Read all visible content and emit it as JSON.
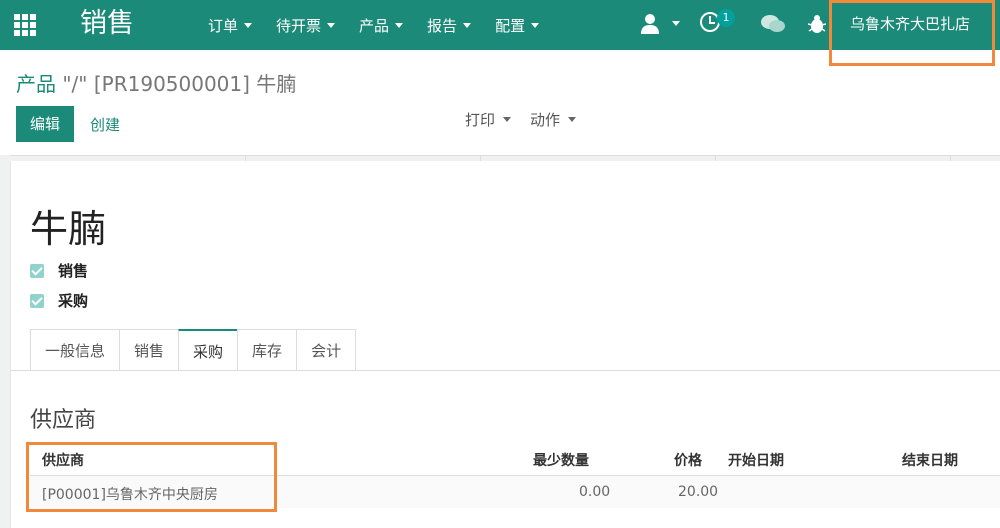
{
  "navbar": {
    "app_title": "销售",
    "menu": [
      "订单",
      "待开票",
      "产品",
      "报告",
      "配置"
    ],
    "activity_count": "1",
    "company": "乌鲁木齐大巴扎店"
  },
  "control_panel": {
    "breadcrumb_link": "产品",
    "breadcrumb_current": "\"/\" [PR190500001] 牛腩",
    "edit_label": "编辑",
    "create_label": "创建",
    "print_label": "打印",
    "action_label": "动作"
  },
  "form": {
    "product_name": "牛腩",
    "checkboxes": [
      {
        "label": "销售",
        "checked": true
      },
      {
        "label": "采购",
        "checked": true
      }
    ],
    "tabs": [
      {
        "label": "一般信息",
        "active": false
      },
      {
        "label": "销售",
        "active": false
      },
      {
        "label": "采购",
        "active": true
      },
      {
        "label": "库存",
        "active": false
      },
      {
        "label": "会计",
        "active": false
      }
    ],
    "section_title": "供应商",
    "vendor_table": {
      "headers": [
        "供应商",
        "最少数量",
        "价格",
        "开始日期",
        "结束日期"
      ],
      "rows": [
        {
          "vendor": "[P00001]乌鲁木齐中央厨房",
          "min_qty": "0.00",
          "price": "20.00",
          "start_date": "",
          "end_date": ""
        }
      ]
    }
  },
  "colors": {
    "primary": "#1b8a78",
    "highlight": "#f08a3a"
  }
}
